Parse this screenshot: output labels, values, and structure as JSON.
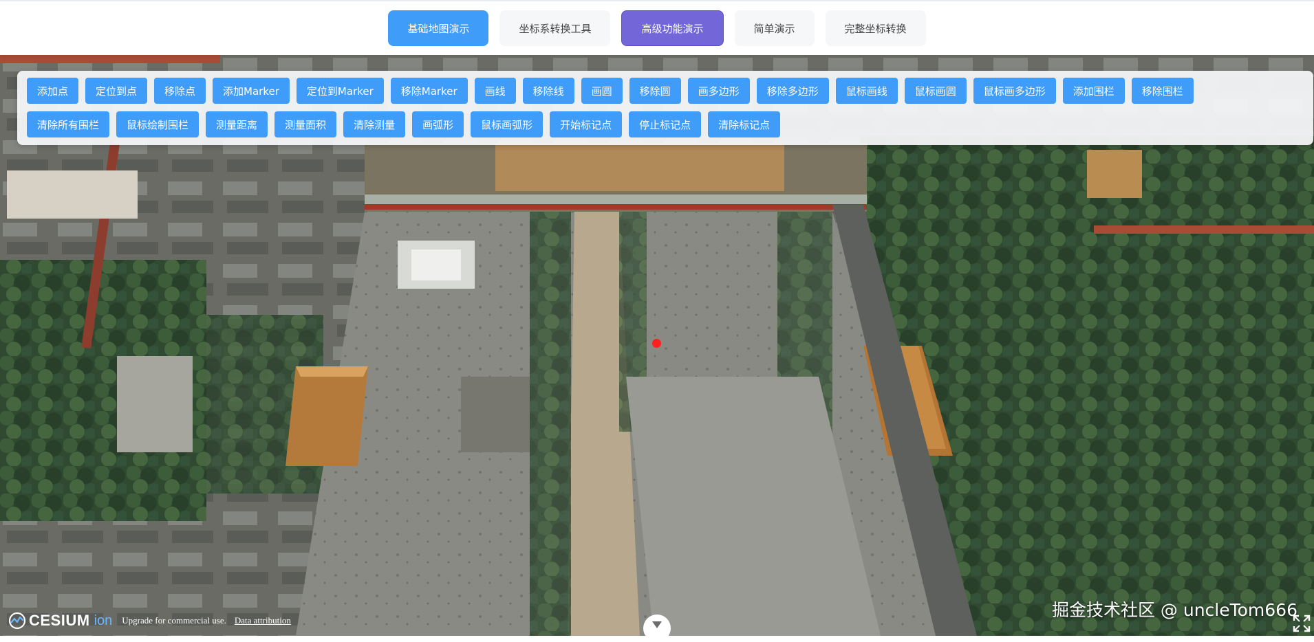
{
  "nav": {
    "tabs": [
      {
        "label": "基础地图演示"
      },
      {
        "label": "坐标系转换工具"
      },
      {
        "label": "高级功能演示"
      },
      {
        "label": "简单演示"
      },
      {
        "label": "完整坐标转换"
      }
    ],
    "active_color": "#3f9cf8",
    "highlight_color": "#7266d8"
  },
  "toolbar": {
    "row1": [
      "添加点",
      "定位到点",
      "移除点",
      "添加Marker",
      "定位到Marker",
      "移除Marker",
      "画线",
      "移除线",
      "画圆",
      "移除圆",
      "画多边形",
      "移除多边形",
      "鼠标画线",
      "鼠标画圆",
      "鼠标画多边形",
      "添加围栏",
      "移除围栏"
    ],
    "row2": [
      "清除所有围栏",
      "鼠标绘制围栏",
      "测量距离",
      "测量面积",
      "清除测量",
      "画弧形",
      "鼠标画弧形",
      "开始标记点",
      "停止标记点",
      "清除标记点"
    ],
    "button_color": "#3f9cf8"
  },
  "map": {
    "watermark": "掘金技术社区 @ uncleTom666",
    "credits": {
      "logo_main": "CESIUM",
      "logo_sub": "ion",
      "upgrade_text": "Upgrade for commercial use.",
      "attribution_link": "Data attribution"
    },
    "marker_color": "#ff1f1f"
  }
}
